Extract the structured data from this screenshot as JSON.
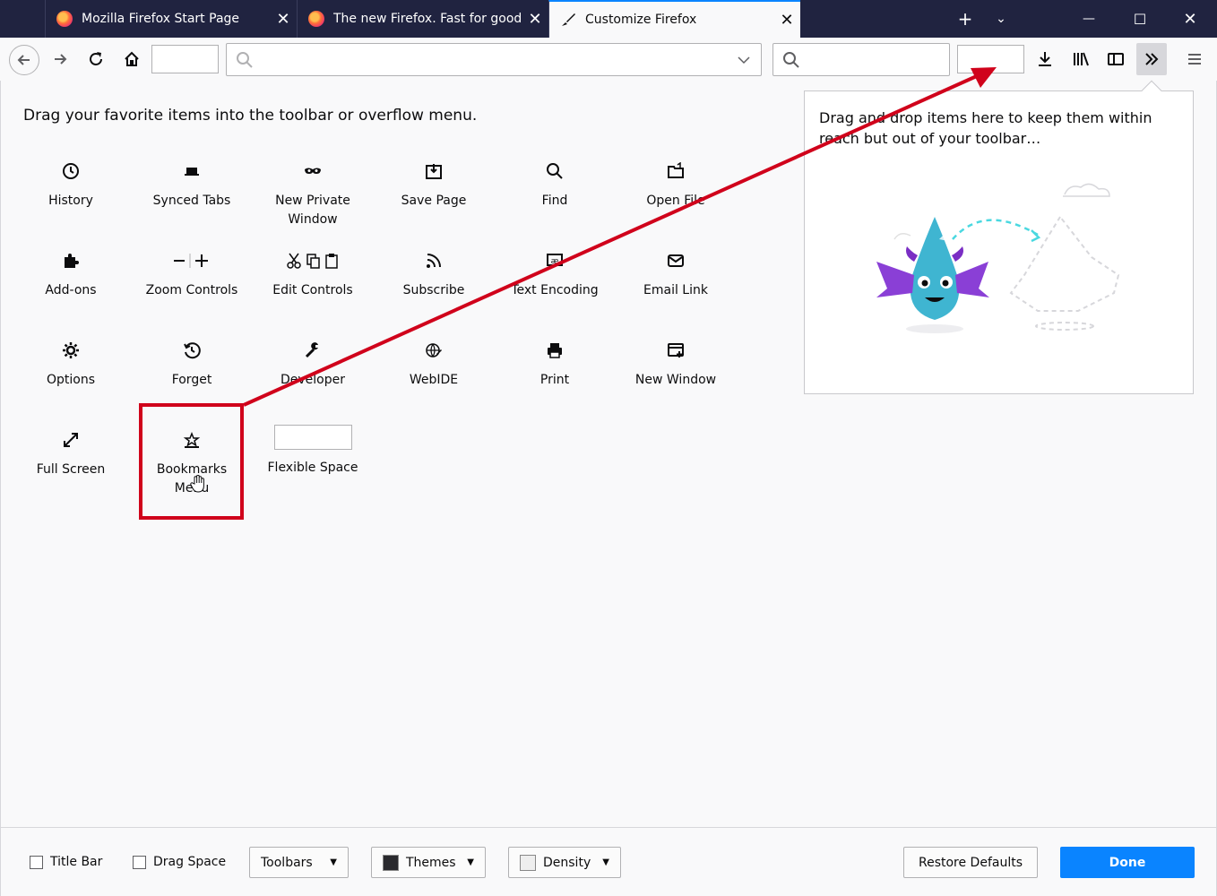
{
  "tabs": [
    {
      "title": "Mozilla Firefox Start Page",
      "active": false
    },
    {
      "title": "The new Firefox. Fast for good.",
      "active": false
    },
    {
      "title": "Customize Firefox",
      "active": true
    }
  ],
  "window_controls": {
    "new_tab": "+",
    "list_all": "⌄",
    "minimize": "—",
    "maximize": "☐",
    "close": "✕"
  },
  "instruction": "Drag your favorite items into the toolbar or overflow menu.",
  "palette_items": [
    {
      "label": "History",
      "icon": "clock-icon"
    },
    {
      "label": "Synced Tabs",
      "icon": "synced-tabs-icon"
    },
    {
      "label": "New Private Window",
      "icon": "private-mask-icon"
    },
    {
      "label": "Save Page",
      "icon": "save-page-icon"
    },
    {
      "label": "Find",
      "icon": "search-icon"
    },
    {
      "label": "Open File",
      "icon": "open-file-icon"
    },
    {
      "label": "Add-ons",
      "icon": "puzzle-icon"
    },
    {
      "label": "Zoom Controls",
      "icon": "zoom-icon"
    },
    {
      "label": "Edit Controls",
      "icon": "edit-controls-icon"
    },
    {
      "label": "Subscribe",
      "icon": "rss-icon"
    },
    {
      "label": "Text Encoding",
      "icon": "text-encoding-icon"
    },
    {
      "label": "Email Link",
      "icon": "mail-icon"
    },
    {
      "label": "Options",
      "icon": "gear-icon"
    },
    {
      "label": "Forget",
      "icon": "forget-icon"
    },
    {
      "label": "Developer",
      "icon": "wrench-icon"
    },
    {
      "label": "WebIDE",
      "icon": "webide-icon"
    },
    {
      "label": "Print",
      "icon": "print-icon"
    },
    {
      "label": "New Window",
      "icon": "new-window-icon"
    },
    {
      "label": "Full Screen",
      "icon": "fullscreen-icon"
    },
    {
      "label": "Bookmarks Menu",
      "icon": "bookmarks-menu-icon"
    },
    {
      "label": "Flexible Space",
      "icon": "flexible-space"
    }
  ],
  "overflow_panel": {
    "text": "Drag and drop items here to keep them within reach but out of your toolbar…"
  },
  "footer": {
    "title_bar": "Title Bar",
    "drag_space": "Drag Space",
    "toolbars": "Toolbars",
    "themes": "Themes",
    "density": "Density",
    "restore_defaults": "Restore Defaults",
    "done": "Done"
  },
  "colors": {
    "titlebar": "#202340",
    "accent": "#0a84ff",
    "annotation": "#d0021b"
  }
}
